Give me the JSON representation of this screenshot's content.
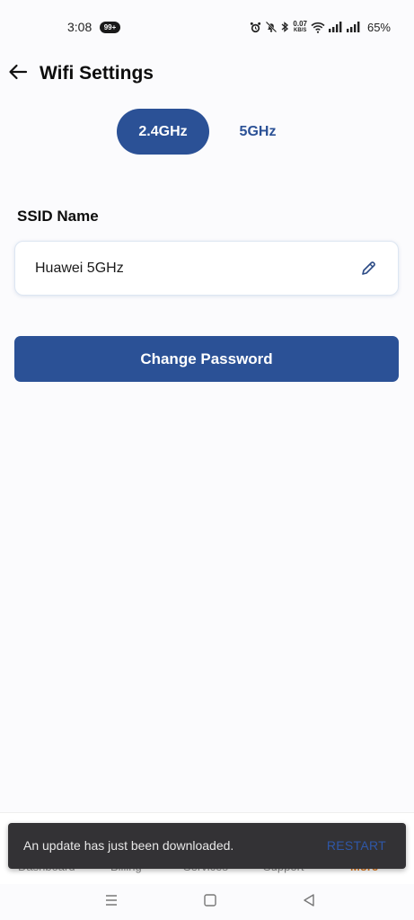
{
  "status_bar": {
    "time": "3:08",
    "notification_count": "99+",
    "net_speed_value": "0.07",
    "net_speed_unit": "KB/S",
    "battery": "65%"
  },
  "header": {
    "title": "Wifi Settings"
  },
  "tabs": [
    {
      "label": "2.4GHz",
      "active": true
    },
    {
      "label": "5GHz",
      "active": false
    }
  ],
  "ssid": {
    "label": "SSID Name",
    "value": "Huawei 5GHz"
  },
  "change_password_label": "Change Password",
  "bottom_nav": {
    "items": [
      "Dashboard",
      "Billing",
      "Services",
      "Support",
      "More"
    ]
  },
  "snackbar": {
    "message": "An update has just been downloaded.",
    "action": "RESTART"
  },
  "colors": {
    "primary": "#2b5196",
    "accent_more": "#e07a1e",
    "snackbar_bg": "#333235"
  },
  "icons": {
    "back": "arrow-left-icon",
    "edit": "pencil-icon",
    "system_menu": "menu-icon",
    "system_home": "square-icon",
    "system_back": "triangle-back-icon"
  }
}
